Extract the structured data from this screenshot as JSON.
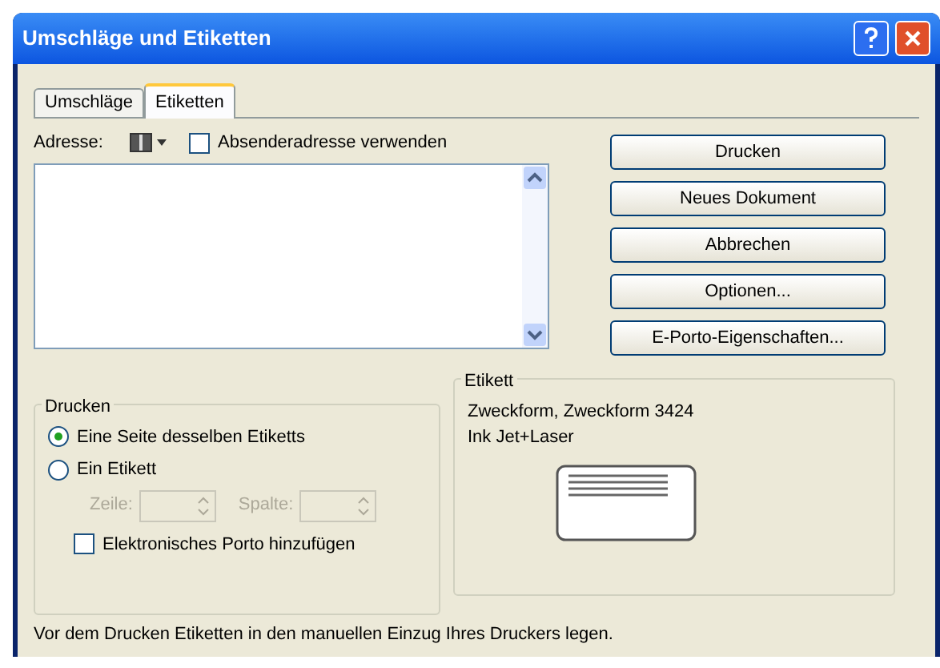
{
  "window": {
    "title": "Umschläge und Etiketten"
  },
  "tabs": [
    {
      "label": "Umschläge",
      "selected": false
    },
    {
      "label": "Etiketten",
      "selected": true
    }
  ],
  "address": {
    "label": "Adresse:",
    "use_sender": {
      "label": "Absenderadresse verwenden",
      "checked": false
    }
  },
  "buttons": [
    "Drucken",
    "Neues Dokument",
    "Abbrechen",
    "Optionen...",
    "E-Porto-Eigenschaften..."
  ],
  "print_group": {
    "title": "Drucken",
    "options": [
      {
        "label": "Eine Seite desselben Etiketts",
        "selected": true
      },
      {
        "label": "Ein Etikett",
        "selected": false
      }
    ],
    "spinners": [
      {
        "label": "Zeile:",
        "disabled": true
      },
      {
        "label": "Spalte:",
        "disabled": true
      }
    ],
    "postage": {
      "label": "Elektronisches Porto hinzufügen",
      "checked": false
    }
  },
  "label_group": {
    "title": "Etikett",
    "lines": [
      "Zweckform, Zweckform 3424",
      "Ink Jet+Laser"
    ]
  },
  "status_text": "Vor dem Drucken Etiketten in den manuellen Einzug Ihres Druckers legen."
}
